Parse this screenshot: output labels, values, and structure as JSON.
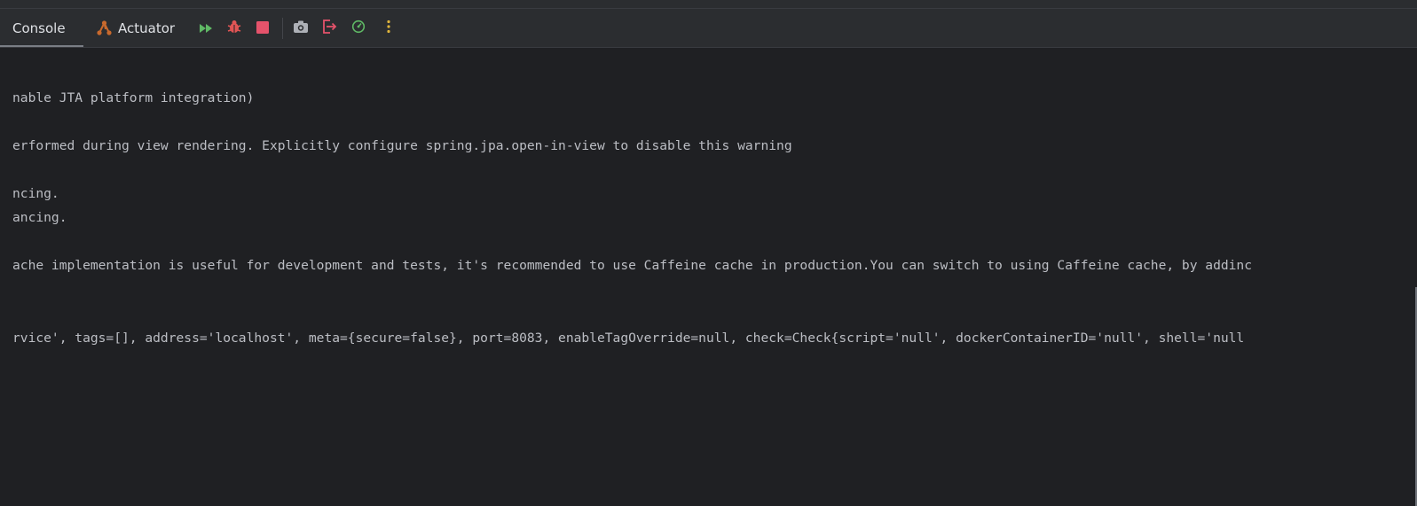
{
  "tabs": {
    "console_label": "Console",
    "actuator_label": "Actuator"
  },
  "toolbar_icons": [
    "rerun-icon",
    "debug-icon",
    "stop-icon",
    "camera-icon",
    "exit-icon",
    "profiler-icon",
    "more-options-icon"
  ],
  "colors": {
    "background": "#1f2023",
    "toolbar": "#2b2d30",
    "text": "#bcbec4",
    "rerun_green": "#5fb865",
    "debug_red": "#e05555",
    "stop_red": "#e5536b",
    "more_yellow": "#e0b53c",
    "actuator_orange": "#c8692d"
  },
  "console": {
    "lines": [
      "nable JTA platform integration)",
      "erformed during view rendering. Explicitly configure spring.jpa.open-in-view to disable this warning",
      "ncing.",
      "ancing.",
      "ache implementation is useful for development and tests, it's recommended to use Caffeine cache in production.You can switch to using Caffeine cache, by addinc",
      "rvice', tags=[], address='localhost', meta={secure=false}, port=8083, enableTagOverride=null, check=Check{script='null', dockerContainerID='null', shell='null"
    ]
  }
}
